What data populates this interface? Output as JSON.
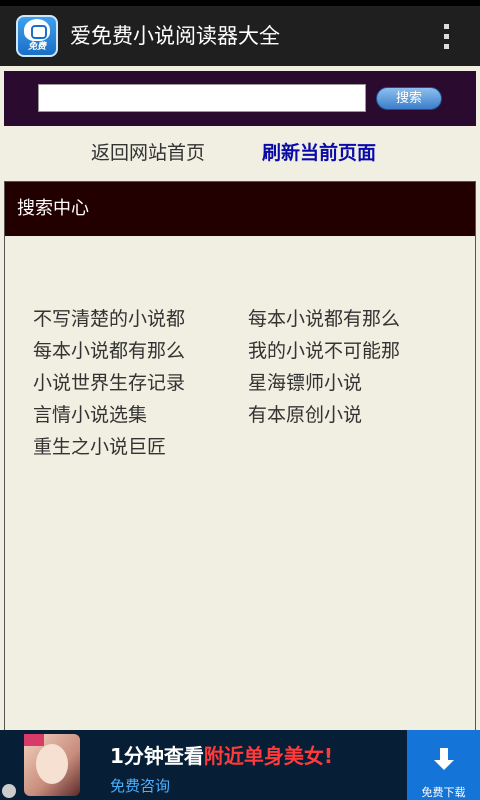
{
  "app": {
    "title": "爱免费小说阅读器大全",
    "icon": "app-logo-icon",
    "icon_sub": "免费"
  },
  "search": {
    "value": "",
    "button_label": "搜索"
  },
  "nav": {
    "home_label": "返回网站首页",
    "refresh_label": "刷新当前页面"
  },
  "search_center": {
    "title": "搜索中心",
    "items": [
      "不写清楚的小说都",
      "每本小说都有那么",
      "每本小说都有那么",
      "我的小说不可能那",
      "小说世界生存记录",
      "星海镖师小说",
      "言情小说选集",
      "有本原创小说",
      "重生之小说巨匠"
    ]
  },
  "ad": {
    "headline_prefix": "1分钟查看",
    "headline_highlight": "附近单身美女!",
    "consult_label": "免费咨询",
    "download_label": "免费下载"
  },
  "colors": {
    "action_bar": "#1f1f1f",
    "search_panel": "#2a0a2e",
    "refresh_link": "#0a0aa8",
    "section_header": "#220000",
    "ad_highlight": "#ff3a3a",
    "download_button": "#1574d8"
  }
}
